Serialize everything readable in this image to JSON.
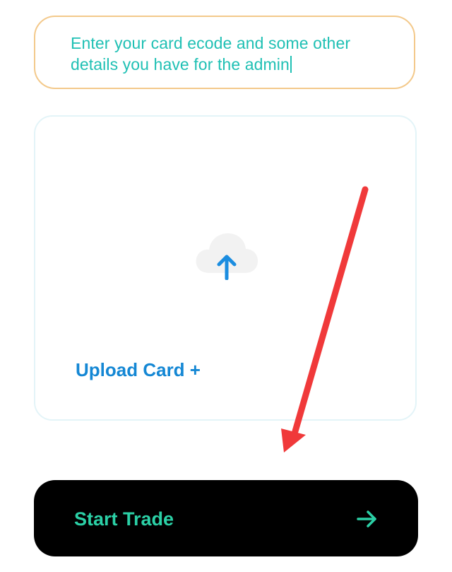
{
  "details_field": {
    "value": "Enter your card ecode and some other details you have for the admin"
  },
  "upload": {
    "label": "Upload Card +",
    "icon": "cloud-upload-icon"
  },
  "start_button": {
    "label": "Start Trade",
    "icon": "arrow-right-icon"
  },
  "colors": {
    "field_border": "#f3c98b",
    "field_text": "#1fc0b4",
    "upload_label": "#1487d4",
    "button_bg": "#000000",
    "button_text": "#2bd0a6",
    "annotation": "#f0393a"
  }
}
